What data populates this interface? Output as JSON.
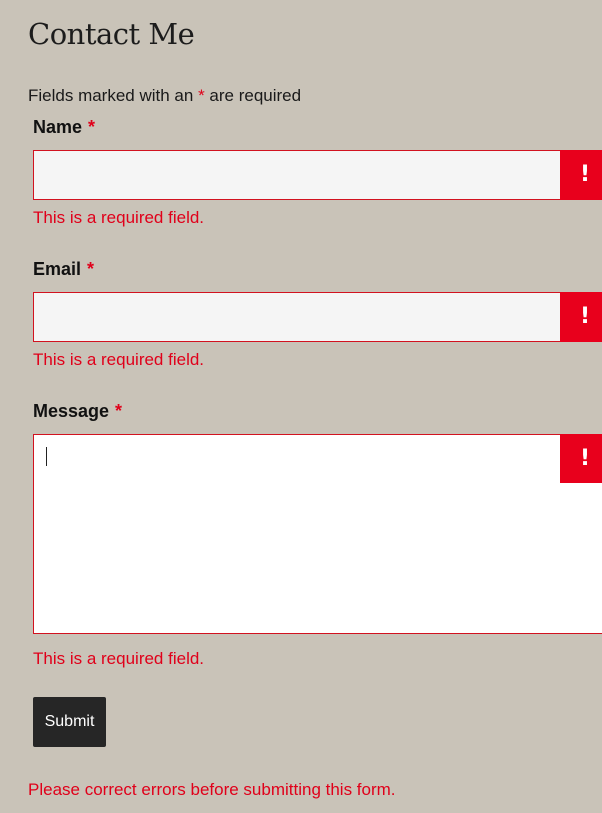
{
  "page": {
    "title": "Contact Me",
    "required_note_before": "Fields marked with an ",
    "required_marker": "*",
    "required_note_after": " are required"
  },
  "colors": {
    "background": "#c9c3b8",
    "error": "#e0001a",
    "button": "#262626"
  },
  "fields": {
    "name": {
      "label": "Name",
      "marker": "*",
      "value": "",
      "error": "This is a required field.",
      "badge": "!"
    },
    "email": {
      "label": "Email",
      "marker": "*",
      "value": "",
      "error": "This is a required field.",
      "badge": "!"
    },
    "message": {
      "label": "Message",
      "marker": "*",
      "value": "",
      "error": "This is a required field.",
      "badge": "!"
    }
  },
  "submit": {
    "label": "Submit"
  },
  "form_error": "Please correct errors before submitting this form."
}
